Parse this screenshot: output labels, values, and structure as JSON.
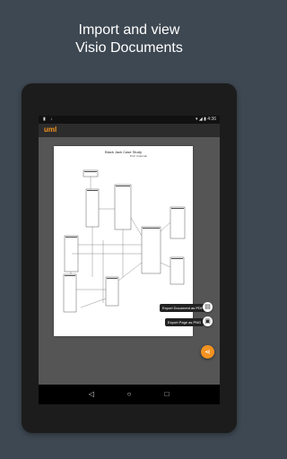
{
  "headline": {
    "line1": "Import and view",
    "line2": "Visio Documents"
  },
  "statusbar": {
    "left_icons": "▮ ↓",
    "right_text": "▾ ◢ ▮ 4:36"
  },
  "appbar": {
    "title": "uml"
  },
  "document": {
    "title": "Black Jack Case Study",
    "subtitle": "Prof. Coleman"
  },
  "actions": {
    "export_pdf": "Export Document as PDF",
    "export_png": "Export Page as PNG",
    "share_icon": "share-icon",
    "pdf_icon": "pdf-icon",
    "image_icon": "image-icon"
  },
  "navbar": {
    "back": "◁",
    "home": "○",
    "recents": "□"
  },
  "colors": {
    "accent": "#f39221",
    "background": "#3e4852"
  }
}
